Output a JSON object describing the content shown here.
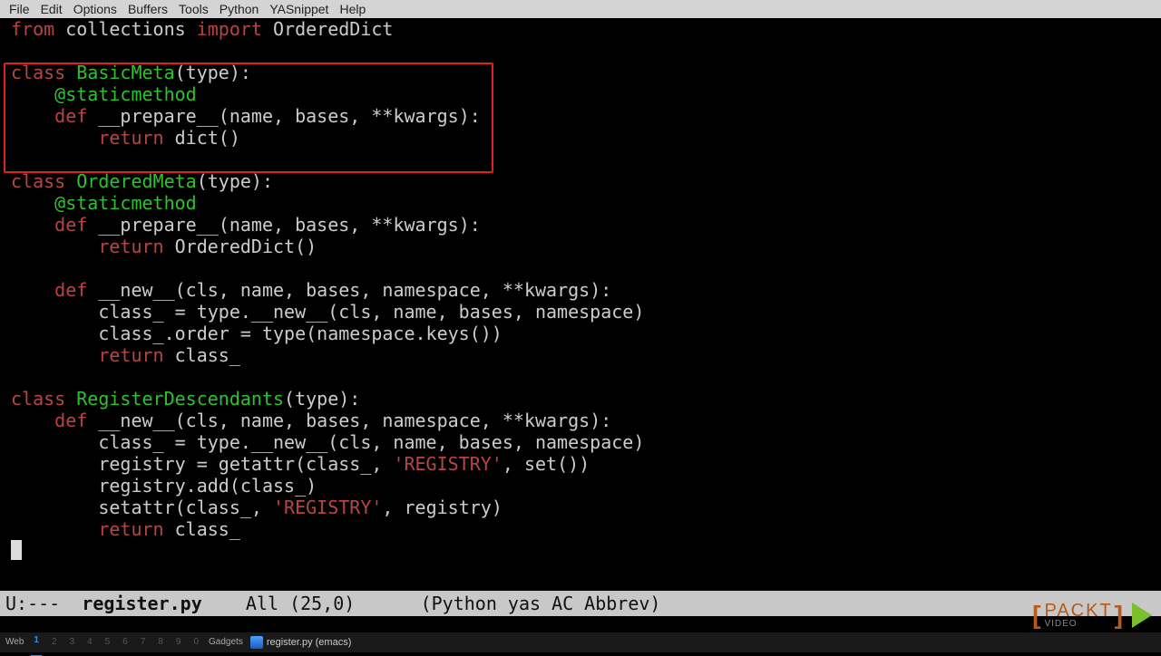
{
  "menubar": {
    "items": [
      "File",
      "Edit",
      "Options",
      "Buffers",
      "Tools",
      "Python",
      "YASnippet",
      "Help"
    ]
  },
  "code": {
    "l1": {
      "kw_from": "from",
      "mod1": "collections",
      "kw_import": "import",
      "mod2": "OrderedDict"
    },
    "basic": {
      "kw_class": "class",
      "name": "BasicMeta",
      "args": "(type):",
      "dec": "@staticmethod",
      "kw_def": "def",
      "fn": "__prepare__",
      "sig": "(name, bases, **kwargs):",
      "kw_return": "return",
      "expr": "dict()"
    },
    "ordered": {
      "kw_class": "class",
      "name": "OrderedMeta",
      "args": "(type):",
      "dec": "@staticmethod",
      "kw_def1": "def",
      "fn1": "__prepare__",
      "sig1": "(name, bases, **kwargs):",
      "kw_ret1": "return",
      "expr1": "OrderedDict()",
      "kw_def2": "def",
      "fn2": "__new__",
      "sig2": "(cls, name, bases, namespace, **kwargs):",
      "b1": "class_ = type.__new__(cls, name, bases, namespace)",
      "b2": "class_.order = type(namespace.keys())",
      "kw_ret2": "return",
      "expr2": "class_"
    },
    "reg": {
      "kw_class": "class",
      "name": "RegisterDescendants",
      "args": "(type):",
      "kw_def": "def",
      "fn": "__new__",
      "sig": "(cls, name, bases, namespace, **kwargs):",
      "b1": "class_ = type.__new__(cls, name, bases, namespace)",
      "b2a": "registry = getattr(class_, ",
      "b2str": "'REGISTRY'",
      "b2b": ", set())",
      "b3": "registry.add(class_)",
      "b4a": "setattr(class_, ",
      "b4str": "'REGISTRY'",
      "b4b": ", registry)",
      "kw_ret": "return",
      "expr": "class_"
    }
  },
  "modeline": {
    "left": "U:---  ",
    "buffer": "register.py",
    "mid": "    All (25,0)      (Python yas AC Abbrev)"
  },
  "taskbar": {
    "label_web": "Web",
    "workspaces": [
      "1",
      "2",
      "3",
      "4",
      "5",
      "6",
      "7",
      "8",
      "9",
      "0"
    ],
    "active_ws": 0,
    "label_gadgets": "Gadgets",
    "task": "register.py (emacs)"
  },
  "logo": {
    "text": "PACKT",
    "sub": "VIDEO"
  }
}
